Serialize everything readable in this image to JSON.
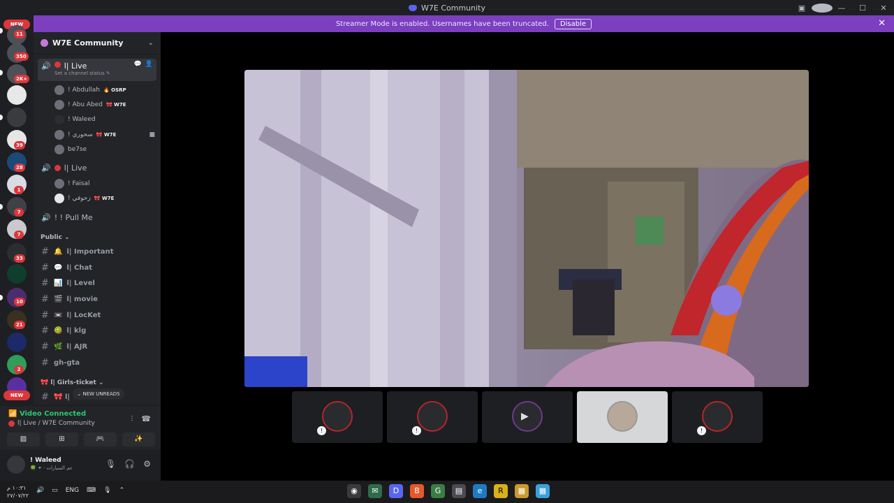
{
  "window": {
    "title": "W7E Community",
    "help": "?",
    "minimize": "—",
    "maximize": "☐",
    "close": "✕",
    "util_icon": "▣"
  },
  "server_rail": {
    "new_top": "NEW",
    "new_bottom": "NEW",
    "badges": [
      "11",
      "350",
      "2K+",
      "39",
      "28",
      "1",
      "7",
      "7",
      "33",
      "10",
      "21",
      "2"
    ]
  },
  "banner": {
    "text": "Streamer Mode is enabled. Usernames have been truncated.",
    "disable_label": "Disable",
    "close": "✕"
  },
  "guild": {
    "name": "W7E Community",
    "chevron": "⌄"
  },
  "voice_channels": [
    {
      "name": "ا| Live",
      "status": "Set a channel status ✎",
      "members": [
        {
          "name": "! Abdullah",
          "tag": "🔥 OSRP"
        },
        {
          "name": "! Abu Abed",
          "tag": "🎀 W7E"
        },
        {
          "name": "! Waleed",
          "tag": ""
        },
        {
          "name": "! سحوري",
          "tag": "🎀 W7E"
        },
        {
          "name": "be7se",
          "tag": ""
        }
      ]
    },
    {
      "name": "ا| Live",
      "members": [
        {
          "name": "! Faisal",
          "tag": ""
        },
        {
          "name": "! زحوفي",
          "tag": "🎀 W7E"
        }
      ]
    },
    {
      "name": "! ! Pull Me"
    }
  ],
  "category_public": "Public ⌄",
  "text_channels": [
    {
      "emoji": "🔔",
      "name": "ا| Important"
    },
    {
      "emoji": "💬",
      "name": "ا| Chat"
    },
    {
      "emoji": "📊",
      "name": "ا| Level"
    },
    {
      "emoji": "🎬",
      "name": "ا| movie"
    },
    {
      "emoji": "📼",
      "name": "ا| LocKet"
    },
    {
      "emoji": "🥝",
      "name": "ا| klg"
    },
    {
      "emoji": "🌿",
      "name": "ا| AJR"
    },
    {
      "emoji": "",
      "name": "gh-gta"
    }
  ],
  "category_girls": "🎀 ا| Girls-ticket ⌄",
  "last_channel": "🎀 ا|",
  "new_unreads": "⌄ NEW UNREADS",
  "voice_panel": {
    "status": "Video Connected",
    "channel": "ا| Live / W7E Community",
    "buttons": [
      "▨",
      "⊞",
      "🎮",
      "✨"
    ]
  },
  "user": {
    "name": "! Waleed",
    "status": "🍀 ✦ · عم السيارات",
    "controls": [
      "🎙",
      "🎧",
      "⚙"
    ]
  },
  "stage": {
    "thumb_mute": "!",
    "thumb_cam": "▶"
  },
  "taskbar": {
    "time": "١٠:٣١ م",
    "date": "٢٧/٠٧/٢٢",
    "tray": [
      "🔊",
      "▭",
      "ENG",
      "⌨",
      "🎙",
      "⌃"
    ],
    "apps": [
      "◉",
      "✉",
      "D",
      "B",
      "G",
      "▤",
      "e",
      "R",
      "▦",
      "▦"
    ]
  },
  "colors": {
    "accent": "#5865f2",
    "banner": "#7b3fbf",
    "danger": "#da373c",
    "connected": "#2dc770"
  }
}
